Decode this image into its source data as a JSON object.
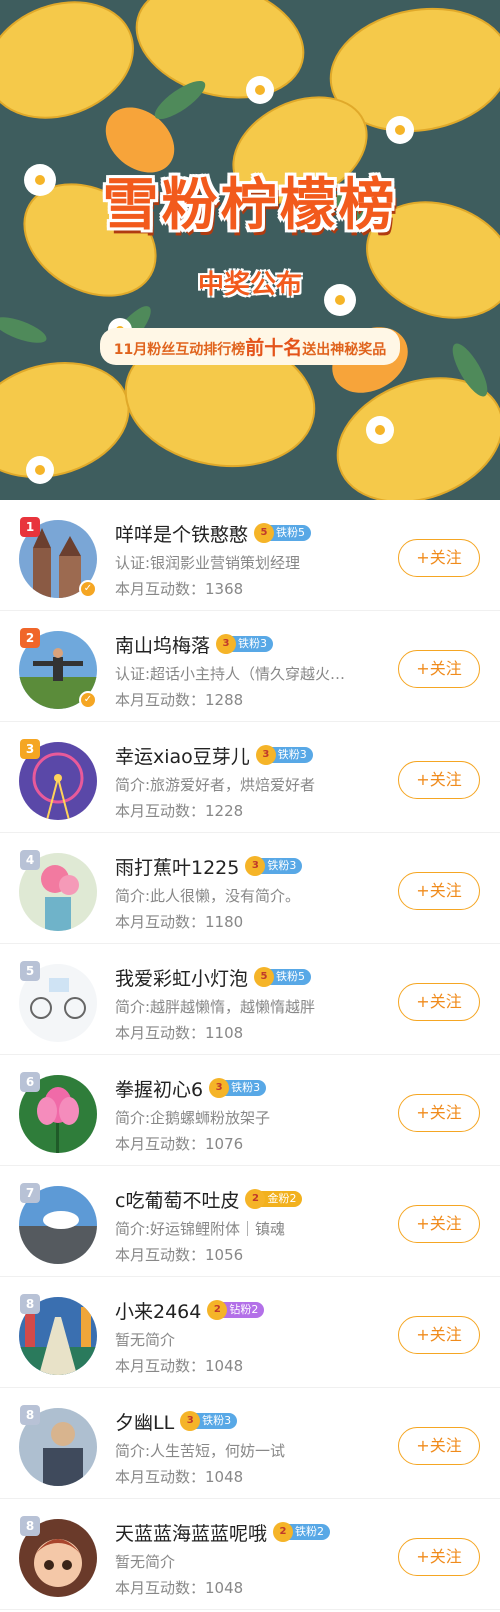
{
  "banner": {
    "title": "雪粉柠檬榜",
    "subtitle": "中奖公布",
    "tagline_prefix": "11月粉丝互动排行榜",
    "tagline_highlight": "前十名",
    "tagline_suffix": "送出神秘奖品"
  },
  "colors": {
    "accent": "#f25a1c",
    "follow_border": "#f5a623",
    "rank1": "#e8343c",
    "rank2": "#f0662a",
    "rank3": "#f5a623",
    "rank_other": "#b8c2d6"
  },
  "follow_label": "+关注",
  "users": [
    {
      "rank": "1",
      "name": "咩咩是个铁憨憨",
      "badge_level": "5",
      "badge": "铁粉5",
      "badge_type": "iron",
      "desc": "认证:银润影业营销策划经理",
      "count": "本月互动数：1368",
      "verified": true,
      "avatar_icon": "church-avatar-icon"
    },
    {
      "rank": "2",
      "name": "南山坞梅落",
      "badge_level": "3",
      "badge": "铁粉3",
      "badge_type": "iron",
      "desc": "认证:超话小主持人（情久穿越火…",
      "count": "本月互动数：1288",
      "verified": true,
      "avatar_icon": "outdoor-avatar-icon"
    },
    {
      "rank": "3",
      "name": "幸运xiao豆芽儿",
      "badge_level": "3",
      "badge": "铁粉3",
      "badge_type": "iron",
      "desc": "简介:旅游爱好者，烘焙爱好者",
      "count": "本月互动数：1228",
      "verified": false,
      "avatar_icon": "ferris-wheel-avatar-icon"
    },
    {
      "rank": "4",
      "name": "雨打蕉叶1225",
      "badge_level": "3",
      "badge": "铁粉3",
      "badge_type": "iron",
      "desc": "简介:此人很懒，没有简介。",
      "count": "本月互动数：1180",
      "verified": false,
      "avatar_icon": "flowers-avatar-icon"
    },
    {
      "rank": "5",
      "name": "我爱彩虹小灯泡",
      "badge_level": "5",
      "badge": "铁粉5",
      "badge_type": "iron",
      "desc": "简介:越胖越懒惰，越懒惰越胖",
      "count": "本月互动数：1108",
      "verified": false,
      "avatar_icon": "cartoon-avatar-icon"
    },
    {
      "rank": "6",
      "name": "拳握初心6",
      "badge_level": "3",
      "badge": "铁粉3",
      "badge_type": "iron",
      "desc": "简介:企鹅螺蛳粉放架子",
      "count": "本月互动数：1076",
      "verified": false,
      "avatar_icon": "lotus-avatar-icon"
    },
    {
      "rank": "7",
      "name": "c吃葡萄不吐皮",
      "badge_level": "2",
      "badge": "金粉2",
      "badge_type": "gold",
      "desc": "简介:好运锦鲤附体｜镇魂",
      "count": "本月互动数：1056",
      "verified": false,
      "avatar_icon": "sky-avatar-icon"
    },
    {
      "rank": "8",
      "name": "小来2464",
      "badge_level": "2",
      "badge": "钻粉2",
      "badge_type": "diamond",
      "desc": "暂无简介",
      "count": "本月互动数：1048",
      "verified": false,
      "avatar_icon": "bridge-avatar-icon"
    },
    {
      "rank": "8",
      "name": "夕幽LL",
      "badge_level": "3",
      "badge": "铁粉3",
      "badge_type": "iron",
      "desc": "简介:人生苦短，何妨一试",
      "count": "本月互动数：1048",
      "verified": false,
      "avatar_icon": "person-avatar-icon"
    },
    {
      "rank": "8",
      "name": "天蓝蓝海蓝蓝呢哦",
      "badge_level": "2",
      "badge": "铁粉2",
      "badge_type": "iron",
      "desc": "暂无简介",
      "count": "本月互动数：1048",
      "verified": false,
      "avatar_icon": "doll-avatar-icon"
    }
  ]
}
